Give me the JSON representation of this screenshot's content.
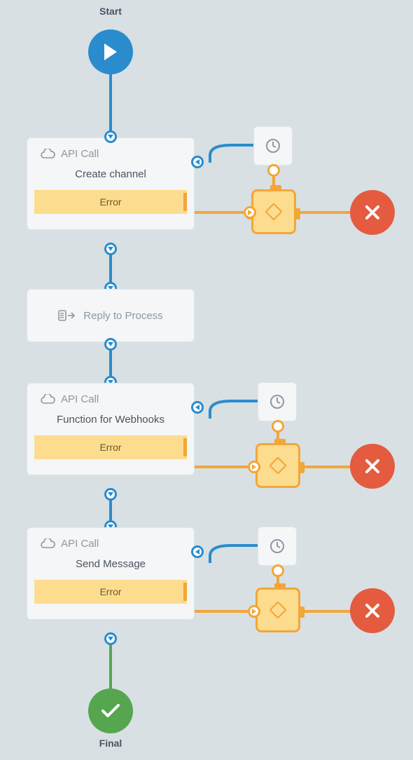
{
  "labels": {
    "start": "Start",
    "final": "Final"
  },
  "nodes": {
    "api_call_label": "API Call",
    "error_label": "Error",
    "reply_label": "Reply to Process",
    "card1_title": "Create channel",
    "card2_title": "Function for Webhooks",
    "card3_title": "Send Message"
  },
  "colors": {
    "blue": "#2a8ccc",
    "green": "#55a64e",
    "orange": "#f3a638",
    "orange_fill": "#fcdc8e",
    "red": "#e45b3f",
    "gray_text": "#8c98a4",
    "dark_text": "#4a5560",
    "bg": "#d8e0e4",
    "card_bg": "#f4f6f7"
  }
}
